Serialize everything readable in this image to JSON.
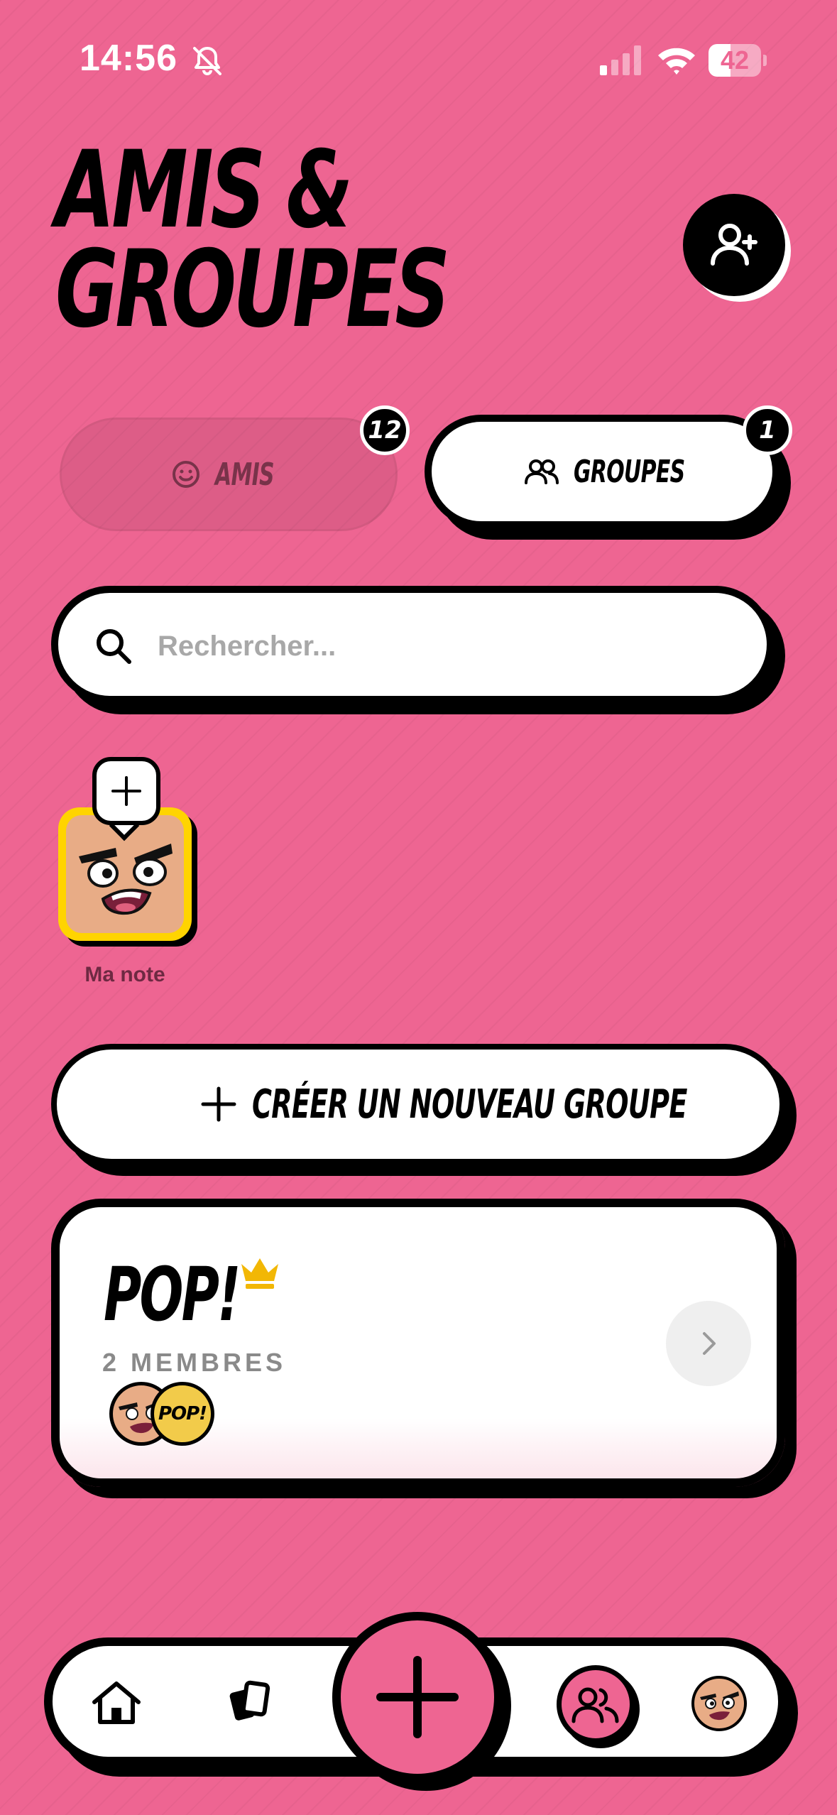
{
  "status_bar": {
    "time": "14:56",
    "battery": {
      "percent": "42",
      "level": 0.42
    },
    "icons": [
      "bell-slash-icon",
      "signal-icon",
      "wifi-icon",
      "battery-icon"
    ]
  },
  "header": {
    "title_line1": "AMIS &",
    "title_line2": "GROUPES",
    "add_friend_icon": "add-user-icon"
  },
  "tabs": [
    {
      "label": "AMIS",
      "count": "12",
      "icon": "smiley-icon",
      "active": false
    },
    {
      "label": "GROUPES",
      "count": "1",
      "icon": "users-icon",
      "active": true
    }
  ],
  "search": {
    "placeholder": "Rechercher...",
    "value": "",
    "icon": "search-icon"
  },
  "note": {
    "label": "Ma note",
    "add_icon": "plus-icon"
  },
  "create_group": {
    "label": "CRÉER UN NOUVEAU GROUPE",
    "icon": "plus-icon"
  },
  "groups": [
    {
      "name": "POP!",
      "members": "2 MEMBRES",
      "owner_icon": "crown-icon",
      "member_avatar_2": "POP!"
    }
  ],
  "bottom_nav": {
    "items": [
      "home-icon",
      "cards-icon",
      "plus-icon",
      "users-icon",
      "profile-avatar"
    ],
    "active": "users-icon"
  },
  "colors": {
    "background": "#EE6592",
    "accent_yellow": "#FFD400",
    "crown": "#F2B705",
    "text_muted": "#8A8A8A"
  }
}
